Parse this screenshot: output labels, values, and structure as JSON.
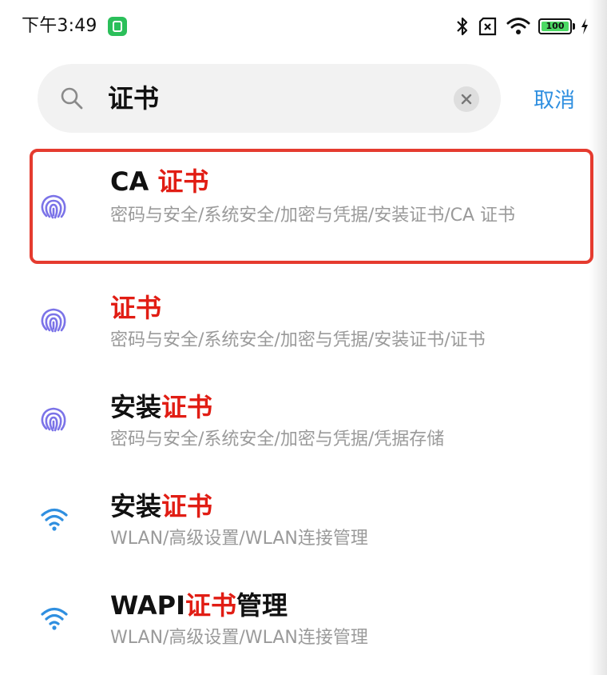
{
  "status_bar": {
    "time": "下午3:49",
    "battery": "100"
  },
  "search": {
    "query": "证书",
    "cancel_label": "取消"
  },
  "results": [
    {
      "title_prefix": "CA ",
      "title_match": "证书",
      "title_suffix": "",
      "path": "密码与安全/系统安全/加密与凭据/安装证书/CA 证书",
      "icon": "fingerprint-icon"
    },
    {
      "title_prefix": "",
      "title_match": "证书",
      "title_suffix": "",
      "path": "密码与安全/系统安全/加密与凭据/安装证书/证书",
      "icon": "fingerprint-icon"
    },
    {
      "title_prefix": "安装",
      "title_match": "证书",
      "title_suffix": "",
      "path": "密码与安全/系统安全/加密与凭据/凭据存储",
      "icon": "fingerprint-icon"
    },
    {
      "title_prefix": "安装",
      "title_match": "证书",
      "title_suffix": "",
      "path": "WLAN/高级设置/WLAN连接管理",
      "icon": "wifi-icon"
    },
    {
      "title_prefix": "WAPI",
      "title_match": "证书",
      "title_suffix": "管理",
      "path": "WLAN/高级设置/WLAN连接管理",
      "icon": "wifi-icon"
    }
  ],
  "colors": {
    "highlight_text": "#e11d14",
    "fingerprint_icon": "#7b73e8",
    "wifi_icon": "#2f8fe0",
    "cancel": "#2f8fe0",
    "annotation_box": "#e53b2f"
  }
}
